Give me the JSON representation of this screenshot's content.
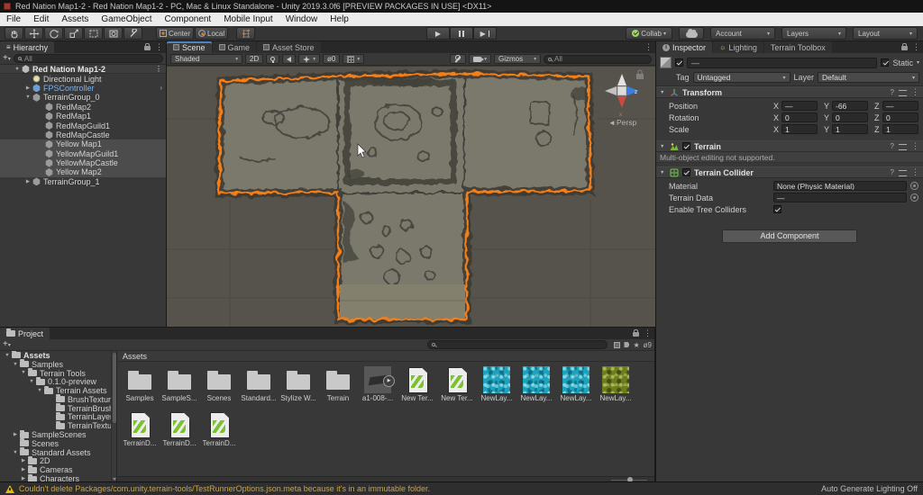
{
  "titlebar": {
    "title": "Red Nation Map1-2 - Red Nation Map1-2 - PC, Mac & Linux Standalone - Unity 2019.3.0f6 [PREVIEW PACKAGES IN USE] <DX11>"
  },
  "menubar": {
    "items": [
      "File",
      "Edit",
      "Assets",
      "GameObject",
      "Component",
      "Mobile Input",
      "Window",
      "Help"
    ]
  },
  "toolbar": {
    "pivot": "Center",
    "orientation": "Local",
    "collab": "Collab",
    "account": "Account",
    "layers": "Layers",
    "layout": "Layout"
  },
  "hierarchy": {
    "tab": "Hierarchy",
    "search_value": "All",
    "items": [
      {
        "label": "Red Nation Map1-2",
        "expander": "▼",
        "icon": "i-unity hex",
        "cls": "scene-row",
        "style": "padding-left:14px",
        "chev": "⋮"
      },
      {
        "label": "Directional Light",
        "expander": "",
        "icon": "i-light",
        "cls": "",
        "style": "padding-left:26px",
        "chev": ""
      },
      {
        "label": "FPSController",
        "expander": "▶",
        "icon": "i-prefab hex",
        "cls": "prefab",
        "style": "padding-left:26px",
        "chev": "›"
      },
      {
        "label": "TerrainGroup_0",
        "expander": "▼",
        "icon": "i-go hex",
        "cls": "",
        "style": "padding-left:26px",
        "chev": ""
      },
      {
        "label": "RedMap2",
        "expander": "",
        "icon": "i-go hex",
        "cls": "",
        "style": "padding-left:40px",
        "chev": ""
      },
      {
        "label": "RedMap1",
        "expander": "",
        "icon": "i-go hex",
        "cls": "",
        "style": "padding-left:40px",
        "chev": ""
      },
      {
        "label": "RedMapGuild1",
        "expander": "",
        "icon": "i-go hex",
        "cls": "",
        "style": "padding-left:40px",
        "chev": ""
      },
      {
        "label": "RedMapCastle",
        "expander": "",
        "icon": "i-go hex",
        "cls": "",
        "style": "padding-left:40px",
        "chev": ""
      },
      {
        "label": "Yellow Map1",
        "expander": "",
        "icon": "i-go hex",
        "cls": "sel",
        "style": "padding-left:40px",
        "chev": ""
      },
      {
        "label": "YellowMapGuild1",
        "expander": "",
        "icon": "i-go hex",
        "cls": "sel",
        "style": "padding-left:40px",
        "chev": ""
      },
      {
        "label": "YellowMapCastle",
        "expander": "",
        "icon": "i-go hex",
        "cls": "sel",
        "style": "padding-left:40px",
        "chev": ""
      },
      {
        "label": "Yellow Map2",
        "expander": "",
        "icon": "i-go hex",
        "cls": "sel",
        "style": "padding-left:40px",
        "chev": ""
      },
      {
        "label": "TerrainGroup_1",
        "expander": "▶",
        "icon": "i-go hex",
        "cls": "",
        "style": "padding-left:26px",
        "chev": ""
      }
    ]
  },
  "scene": {
    "tabs": [
      {
        "label": "Scene",
        "cls": "active focus"
      },
      {
        "label": "Game",
        "cls": ""
      },
      {
        "label": "Asset Store",
        "cls": ""
      }
    ],
    "toolbar": {
      "shading": "Shaded",
      "two_d": "2D",
      "hidden_count": "0",
      "gizmos": "Gizmos",
      "search_value": "All"
    },
    "gizmo": {
      "x": "x",
      "z": "z",
      "persp": "Persp",
      "persp_arrow": "◄"
    }
  },
  "inspector": {
    "tabs": [
      "Inspector",
      "Lighting",
      "Terrain Toolbox"
    ],
    "header": {
      "name": "—",
      "static_label": "Static",
      "tag_label": "Tag",
      "tag_value": "Untagged",
      "layer_label": "Layer",
      "layer_value": "Default"
    },
    "axis": {
      "x": "X",
      "y": "Y",
      "z": "Z"
    },
    "transform": {
      "title": "Transform",
      "rows": [
        {
          "label": "Position",
          "x": "—",
          "y": "-66",
          "z": "—"
        },
        {
          "label": "Rotation",
          "x": "0",
          "y": "0",
          "z": "0"
        },
        {
          "label": "Scale",
          "x": "1",
          "y": "1",
          "z": "1"
        }
      ]
    },
    "terrain": {
      "title": "Terrain",
      "message": "Multi-object editing not supported."
    },
    "collider": {
      "title": "Terrain Collider",
      "material_label": "Material",
      "material_value": "None (Physic Material)",
      "terrain_data_label": "Terrain Data",
      "terrain_data_value": "—",
      "tree_colliders_label": "Enable Tree Colliders"
    },
    "add_component": "Add Component"
  },
  "project": {
    "tab": "Project",
    "breadcrumb": "Assets",
    "hidden_count": "ø9",
    "tree": [
      {
        "label": "Assets",
        "expander": "▼",
        "cls": "bold",
        "style": "padding-left:3px"
      },
      {
        "label": "Samples",
        "expander": "▼",
        "cls": "",
        "style": "padding-left:12px"
      },
      {
        "label": "Terrain Tools",
        "expander": "▼",
        "cls": "",
        "style": "padding-left:21px"
      },
      {
        "label": "0.1.0-preview",
        "expander": "▼",
        "cls": "",
        "style": "padding-left:30px"
      },
      {
        "label": "Terrain Assets",
        "expander": "▼",
        "cls": "",
        "style": "padding-left:39px"
      },
      {
        "label": "BrushTextures",
        "expander": "",
        "cls": "",
        "style": "padding-left:52px"
      },
      {
        "label": "TerrainBrushes",
        "expander": "",
        "cls": "",
        "style": "padding-left:52px"
      },
      {
        "label": "TerrainLayers",
        "expander": "",
        "cls": "",
        "style": "padding-left:52px"
      },
      {
        "label": "TerrainTextures",
        "expander": "",
        "cls": "",
        "style": "padding-left:52px"
      },
      {
        "label": "SampleScenes",
        "expander": "▶",
        "cls": "",
        "style": "padding-left:12px"
      },
      {
        "label": "Scenes",
        "expander": "",
        "cls": "",
        "style": "padding-left:12px"
      },
      {
        "label": "Standard Assets",
        "expander": "▼",
        "cls": "",
        "style": "padding-left:12px"
      },
      {
        "label": "2D",
        "expander": "▶",
        "cls": "",
        "style": "padding-left:21px"
      },
      {
        "label": "Cameras",
        "expander": "▶",
        "cls": "",
        "style": "padding-left:21px"
      },
      {
        "label": "Characters",
        "expander": "▶",
        "cls": "",
        "style": "padding-left:21px"
      }
    ],
    "assets": [
      {
        "label": "Samples",
        "kind": "k-folder"
      },
      {
        "label": "SampleS...",
        "kind": "k-folder"
      },
      {
        "label": "Scenes",
        "kind": "k-folder"
      },
      {
        "label": "Standard...",
        "kind": "k-folder"
      },
      {
        "label": "Stylize W...",
        "kind": "k-folder"
      },
      {
        "label": "Terrain",
        "kind": "k-folder"
      },
      {
        "label": "a1-008-...",
        "kind": "k-model"
      },
      {
        "label": "New Ter...",
        "kind": "k-tdata"
      },
      {
        "label": "New Ter...",
        "kind": "k-tdata"
      },
      {
        "label": "NewLay...",
        "kind": "k-texblue"
      },
      {
        "label": "NewLay...",
        "kind": "k-texblue"
      },
      {
        "label": "NewLay...",
        "kind": "k-texblue"
      },
      {
        "label": "NewLay...",
        "kind": "k-texgreen"
      },
      {
        "label": "TerrainD...",
        "kind": "k-tdata"
      },
      {
        "label": "TerrainD...",
        "kind": "k-tdata"
      },
      {
        "label": "TerrainD...",
        "kind": "k-tdata"
      }
    ]
  },
  "statusbar": {
    "message": "Couldn't delete Packages/com.unity.terrain-tools/TestRunnerOptions.json.meta because it's in an immutable folder.",
    "lighting": "Auto Generate Lighting Off"
  },
  "icons": {
    "dropdown": "▾",
    "kebab": "⋮",
    "plus": "+",
    "play": "▶",
    "info": "i",
    "lighting_tab": "☼",
    "help": "?",
    "hamburger": "≡",
    "eye_hidden": "ø0",
    "star": "★"
  },
  "colors": {
    "selection_outline": "#f57e14",
    "prefab_text": "#7fb1e8",
    "warning_text": "#cfa43a",
    "focused_tab_accent": "#4f83c2"
  }
}
